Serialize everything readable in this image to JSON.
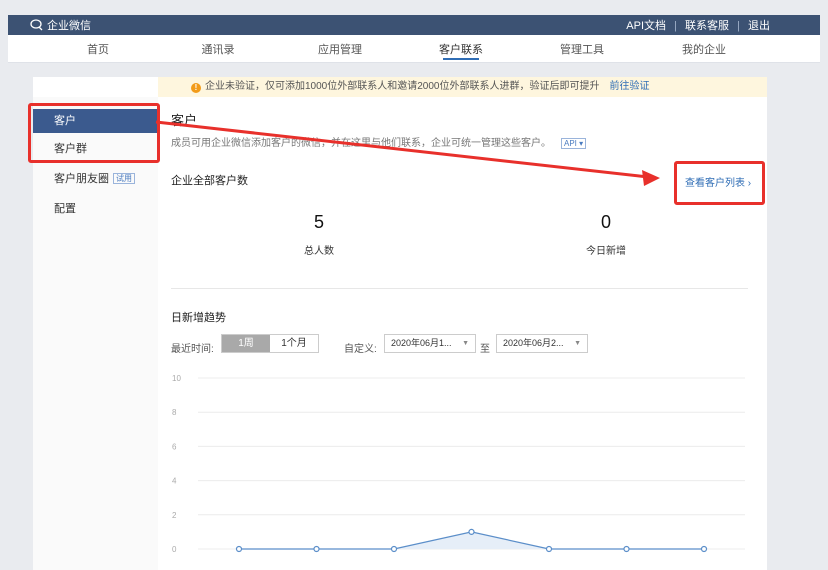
{
  "app": {
    "logo_text": "企业微信"
  },
  "top_links": {
    "api_docs": "API文档",
    "sep1": "|",
    "support": "联系客服",
    "sep2": "|",
    "logout": "退出"
  },
  "nav": {
    "items": [
      {
        "label": "首页"
      },
      {
        "label": "通讯录"
      },
      {
        "label": "应用管理"
      },
      {
        "label": "客户联系",
        "active": true
      },
      {
        "label": "管理工具"
      },
      {
        "label": "我的企业"
      }
    ]
  },
  "notice": {
    "text": "企业未验证，仅可添加1000位外部联系人和邀请2000位外部联系人进群，验证后即可提升",
    "link": "前往验证"
  },
  "sidebar": {
    "items": [
      {
        "label": "客户",
        "active": true
      },
      {
        "label": "客户群"
      },
      {
        "label": "客户朋友圈",
        "tag": "试用"
      },
      {
        "label": "配置"
      }
    ]
  },
  "main": {
    "title": "客户",
    "description": "成员可用企业微信添加客户的微信，并在这里与他们联系，企业可统一管理这些客户。",
    "api_tag": "API ▾",
    "section_title": "企业全部客户数",
    "view_list_link": "查看客户列表 ›",
    "stats": [
      {
        "value": "5",
        "label": "总人数"
      },
      {
        "value": "0",
        "label": "今日新增"
      }
    ],
    "trend_title": "日新增趋势",
    "range_label": "最近时间:",
    "range_options": [
      "1周",
      "1个月"
    ],
    "custom_label": "自定义:",
    "date_from": "2020年06月1...",
    "to_label": "至",
    "date_to": "2020年06月2..."
  },
  "colors": {
    "accent": "#3b5a8e",
    "highlight": "#e8302b",
    "line": "#5b8ec9"
  },
  "chart_data": {
    "type": "line",
    "yticks": [
      "10",
      "8",
      "6",
      "4",
      "2",
      "0"
    ],
    "ylim": [
      0,
      10
    ],
    "series": [
      {
        "values": [
          0,
          0,
          0,
          1,
          0,
          0,
          0
        ]
      }
    ],
    "grid": true
  }
}
